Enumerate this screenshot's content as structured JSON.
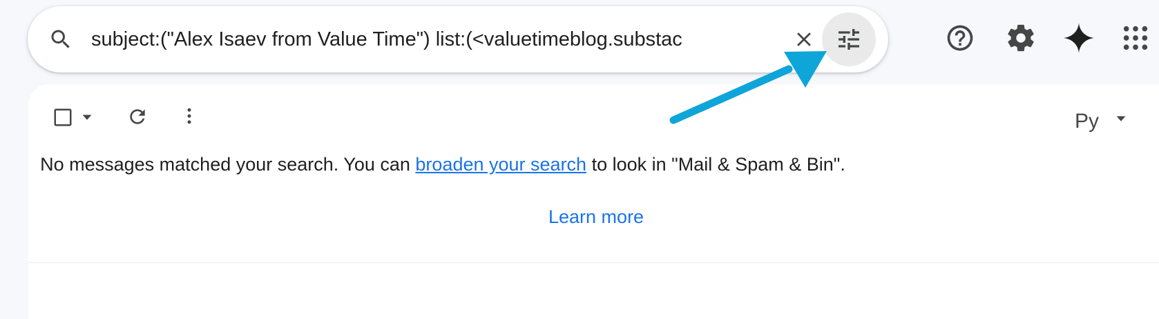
{
  "search": {
    "query": "subject:(\"Alex Isaev from Value Time\") list:(<valuetimeblog.substac",
    "icon": "search-icon",
    "clear_icon": "close-icon",
    "options_icon": "search-options-icon"
  },
  "top_icons": [
    "help-icon",
    "settings-icon",
    "gemini-icon",
    "apps-icon"
  ],
  "toolbar": {
    "select_icon": "checkbox-icon",
    "select_dropdown_icon": "chevron-down-icon",
    "refresh_icon": "refresh-icon",
    "more_icon": "more-vert-icon",
    "language_label": "Py"
  },
  "empty_state": {
    "message_before": "No messages matched your search. You can ",
    "link_text": "broaden your search",
    "message_after": " to look in \"Mail & Spam & Bin\".",
    "learn_more": "Learn more"
  },
  "colors": {
    "background": "#f6f8fc",
    "link": "#1a73e8",
    "annotation_arrow": "#0ea5d8"
  }
}
